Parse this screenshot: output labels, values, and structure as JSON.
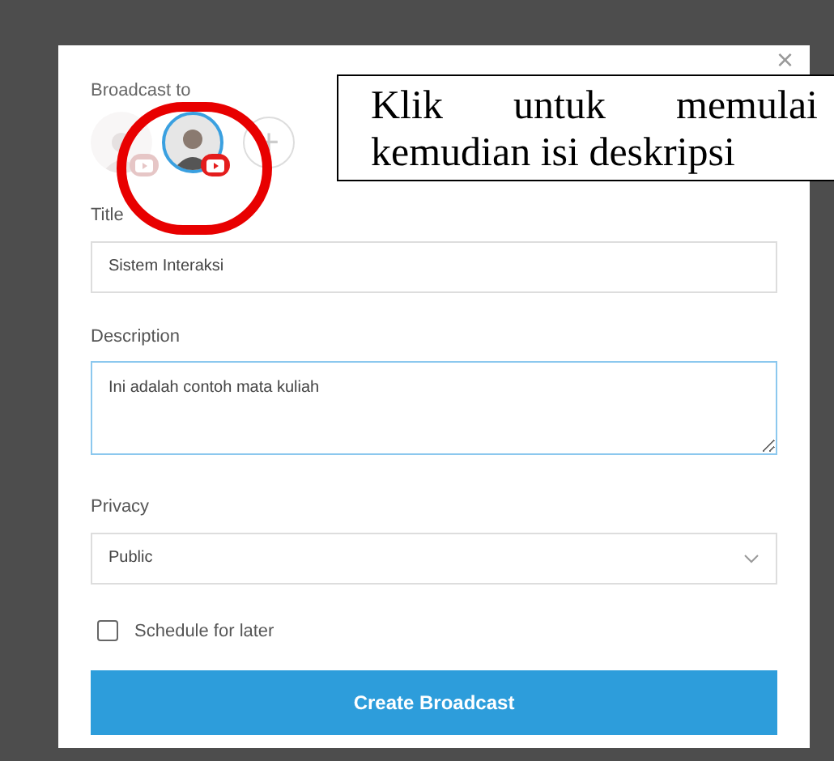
{
  "dialog": {
    "close": "×",
    "broadcast_to": {
      "label": "Broadcast to",
      "accounts": [
        {
          "selected": false
        },
        {
          "selected": true
        }
      ],
      "add": "+"
    },
    "title": {
      "label": "Title",
      "value": "Sistem Interaksi"
    },
    "description": {
      "label": "Description",
      "value": "Ini adalah contoh mata kuliah",
      "focused": true
    },
    "privacy": {
      "label": "Privacy",
      "value": "Public"
    },
    "schedule": {
      "label": "Schedule for later",
      "checked": false
    },
    "submit": "Create Broadcast"
  },
  "annotation": {
    "callout": "Klik untuk memulai kemudian isi deskripsi"
  }
}
